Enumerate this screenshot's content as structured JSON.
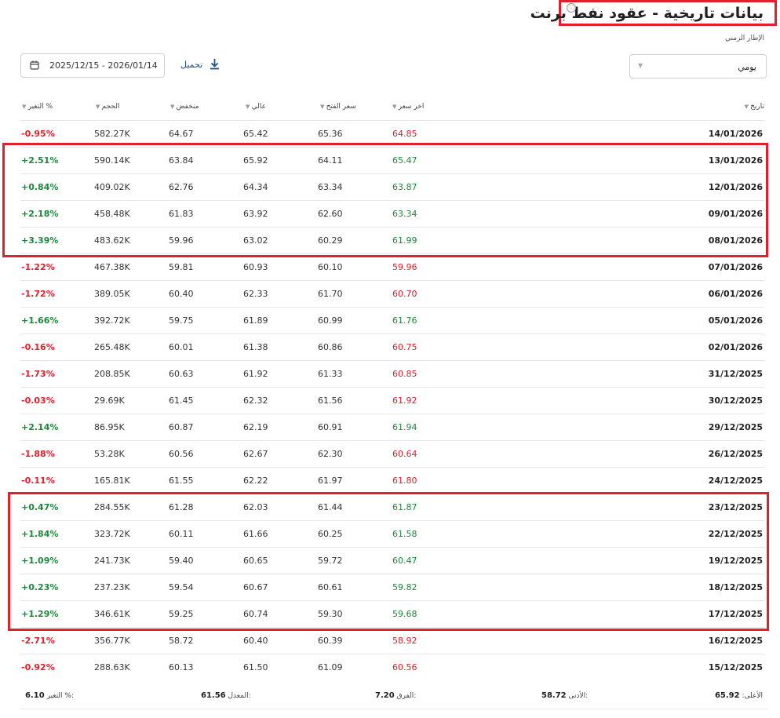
{
  "page": {
    "title": "بيانات تاريخية - عقود نفط برنت",
    "info_icon": "ⓘ",
    "timeframe_label": "الإطار الزمني",
    "timeframe_value": "يومي",
    "date_range": "2025/12/15 - 2026/01/14",
    "download_label": "تحميل"
  },
  "colors": {
    "up": "#1a8a3a",
    "down": "#e0202a",
    "highlight": "#e0202a"
  },
  "table": {
    "headers": {
      "date": "تاريخ",
      "last": "اخر سعر",
      "open": "سعر الفتح",
      "high": "عالي",
      "low": "منخفض",
      "volume": "الحجم",
      "change": "التغير %"
    },
    "rows": [
      {
        "date": "14/01/2026",
        "last": "64.85",
        "open": "65.36",
        "high": "65.42",
        "low": "64.67",
        "volume": "582.27K",
        "change": "-0.95%",
        "dir": "down"
      },
      {
        "date": "13/01/2026",
        "last": "65.47",
        "open": "64.11",
        "high": "65.92",
        "low": "63.84",
        "volume": "590.14K",
        "change": "+2.51%",
        "dir": "up"
      },
      {
        "date": "12/01/2026",
        "last": "63.87",
        "open": "63.34",
        "high": "64.34",
        "low": "62.76",
        "volume": "409.02K",
        "change": "+0.84%",
        "dir": "up"
      },
      {
        "date": "09/01/2026",
        "last": "63.34",
        "open": "62.60",
        "high": "63.92",
        "low": "61.83",
        "volume": "458.48K",
        "change": "+2.18%",
        "dir": "up"
      },
      {
        "date": "08/01/2026",
        "last": "61.99",
        "open": "60.29",
        "high": "63.02",
        "low": "59.96",
        "volume": "483.62K",
        "change": "+3.39%",
        "dir": "up"
      },
      {
        "date": "07/01/2026",
        "last": "59.96",
        "open": "60.10",
        "high": "60.93",
        "low": "59.81",
        "volume": "467.38K",
        "change": "-1.22%",
        "dir": "down"
      },
      {
        "date": "06/01/2026",
        "last": "60.70",
        "open": "61.70",
        "high": "62.33",
        "low": "60.40",
        "volume": "389.05K",
        "change": "-1.72%",
        "dir": "down"
      },
      {
        "date": "05/01/2026",
        "last": "61.76",
        "open": "60.99",
        "high": "61.89",
        "low": "59.75",
        "volume": "392.72K",
        "change": "+1.66%",
        "dir": "up"
      },
      {
        "date": "02/01/2026",
        "last": "60.75",
        "open": "60.86",
        "high": "61.38",
        "low": "60.01",
        "volume": "265.48K",
        "change": "-0.16%",
        "dir": "down"
      },
      {
        "date": "31/12/2025",
        "last": "60.85",
        "open": "61.33",
        "high": "61.92",
        "low": "60.63",
        "volume": "208.85K",
        "change": "-1.73%",
        "dir": "down"
      },
      {
        "date": "30/12/2025",
        "last": "61.92",
        "open": "61.56",
        "high": "62.32",
        "low": "61.45",
        "volume": "29.69K",
        "change": "-0.03%",
        "dir": "down"
      },
      {
        "date": "29/12/2025",
        "last": "61.94",
        "open": "60.91",
        "high": "62.19",
        "low": "60.87",
        "volume": "86.95K",
        "change": "+2.14%",
        "dir": "up"
      },
      {
        "date": "26/12/2025",
        "last": "60.64",
        "open": "62.30",
        "high": "62.67",
        "low": "60.56",
        "volume": "53.28K",
        "change": "-1.88%",
        "dir": "down"
      },
      {
        "date": "24/12/2025",
        "last": "61.80",
        "open": "61.97",
        "high": "62.22",
        "low": "61.55",
        "volume": "165.81K",
        "change": "-0.11%",
        "dir": "down"
      },
      {
        "date": "23/12/2025",
        "last": "61.87",
        "open": "61.44",
        "high": "62.03",
        "low": "61.28",
        "volume": "284.55K",
        "change": "+0.47%",
        "dir": "up"
      },
      {
        "date": "22/12/2025",
        "last": "61.58",
        "open": "60.25",
        "high": "61.66",
        "low": "60.11",
        "volume": "323.72K",
        "change": "+1.84%",
        "dir": "up"
      },
      {
        "date": "19/12/2025",
        "last": "60.47",
        "open": "59.72",
        "high": "60.65",
        "low": "59.40",
        "volume": "241.73K",
        "change": "+1.09%",
        "dir": "up"
      },
      {
        "date": "18/12/2025",
        "last": "59.82",
        "open": "60.61",
        "high": "60.67",
        "low": "59.54",
        "volume": "237.23K",
        "change": "+0.23%",
        "dir": "up"
      },
      {
        "date": "17/12/2025",
        "last": "59.68",
        "open": "59.30",
        "high": "60.74",
        "low": "59.25",
        "volume": "346.61K",
        "change": "+1.29%",
        "dir": "up"
      },
      {
        "date": "16/12/2025",
        "last": "58.92",
        "open": "60.39",
        "high": "60.40",
        "low": "58.72",
        "volume": "356.77K",
        "change": "-2.71%",
        "dir": "down"
      },
      {
        "date": "15/12/2025",
        "last": "60.56",
        "open": "61.09",
        "high": "61.50",
        "low": "60.13",
        "volume": "288.63K",
        "change": "-0.92%",
        "dir": "down"
      }
    ]
  },
  "summary": {
    "high_label": "الأعلى:",
    "high_value": "65.92",
    "low_label": "الأدنى:",
    "low_value": "58.72",
    "diff_label": "الفرق:",
    "diff_value": "7.20",
    "avg_label": "المعدل:",
    "avg_value": "61.56",
    "change_label": "التغير %:",
    "change_value": "6.10"
  }
}
